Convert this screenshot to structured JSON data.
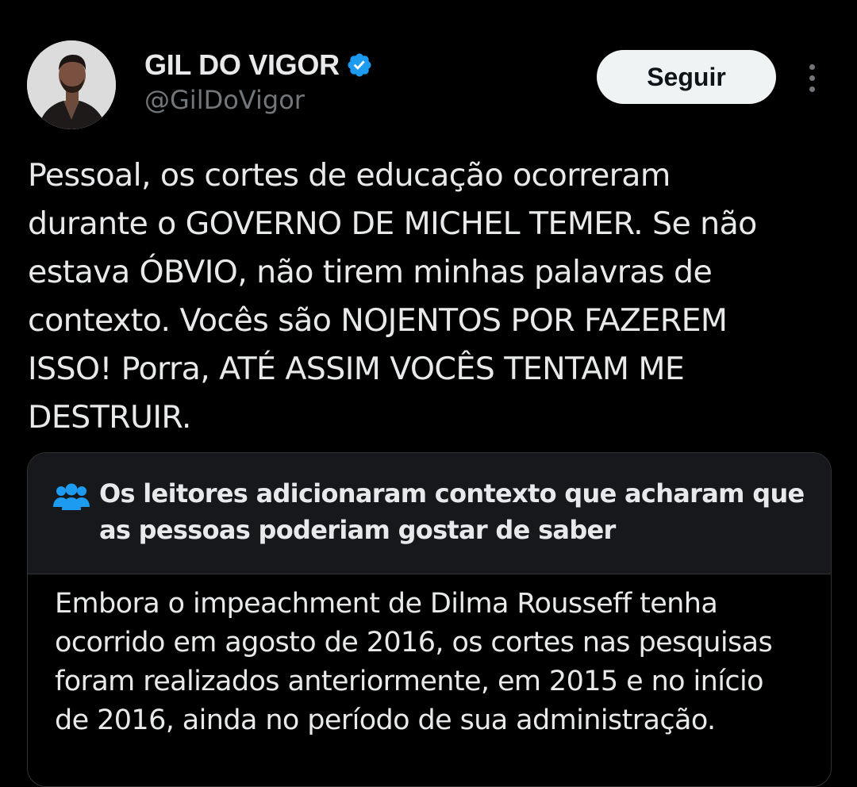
{
  "author": {
    "display_name": "GIL DO VIGOR",
    "handle": "@GilDoVigor",
    "avatar_icon": "avatar-photo",
    "verified_icon": "verified-badge-icon",
    "verified_color": "#1d9bf0"
  },
  "actions": {
    "follow_label": "Seguir",
    "more_icon": "more-options-vertical-icon"
  },
  "tweet": {
    "text": "Pessoal, os cortes de educação ocorreram\ndurante o GOVERNO DE MICHEL TEMER. Se não\nestava ÓBVIO, não tirem minhas palavras de\ncontexto. Vocês são NOJENTOS POR FAZEREM\nISSO! Porra, ATÉ ASSIM VOCÊS TENTAM ME\nDESTRUIR."
  },
  "community_note": {
    "icon": "people-group-icon",
    "icon_color": "#1d9bf0",
    "title": "Os leitores adicionaram contexto que acharam que\nas pessoas poderiam gostar de saber",
    "body": "Embora o impeachment de Dilma Rousseff tenha\nocorrido em agosto de 2016, os cortes nas pesquisas\nforam realizados anteriormente, em 2015 e no início\nde 2016, ainda no período de sua administração."
  },
  "colors": {
    "background": "#000000",
    "text_primary": "#e7e9ea",
    "text_secondary": "#71767b",
    "follow_button_bg": "#eff3f4",
    "note_header_bg": "#16181c",
    "border": "#2f3336"
  }
}
